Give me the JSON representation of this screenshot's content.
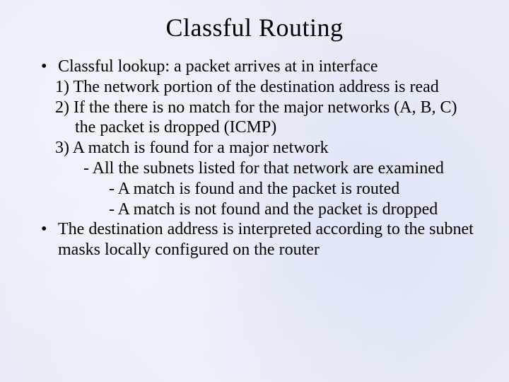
{
  "title": "Classful Routing",
  "bullet1": "Classful lookup: a packet arrives at in interface",
  "step1": "1) The network portion of the destination address is read",
  "step2": "2) If the there is no match for the major networks (A, B, C) the packet is dropped (ICMP)",
  "step3": "3) A match is found for a major network",
  "step3a": "- All the subnets listed for that network are examined",
  "step3a1": "- A match is found and the packet is routed",
  "step3a2": "- A match is not found and the packet is dropped",
  "bullet2": "The destination address is interpreted according to the subnet masks locally configured on the router",
  "dot": "•"
}
